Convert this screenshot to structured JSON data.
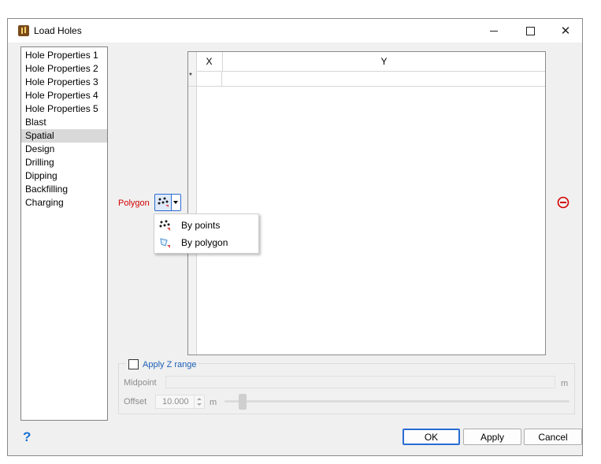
{
  "window": {
    "title": "Load Holes",
    "icon": "load-holes-app-icon",
    "controls": {
      "minimize": "minimize-icon",
      "maximize": "maximize-icon",
      "close": "close-icon",
      "close_glyph": "✕"
    }
  },
  "sidebar": {
    "items": [
      {
        "label": "Hole Properties 1"
      },
      {
        "label": "Hole Properties 2"
      },
      {
        "label": "Hole Properties 3"
      },
      {
        "label": "Hole Properties 4"
      },
      {
        "label": "Hole Properties 5"
      },
      {
        "label": "Blast"
      },
      {
        "label": "Spatial",
        "selected": true
      },
      {
        "label": "Design"
      },
      {
        "label": "Drilling"
      },
      {
        "label": "Dipping"
      },
      {
        "label": "Backfilling"
      },
      {
        "label": "Charging"
      }
    ]
  },
  "polygon": {
    "label": "Polygon",
    "label_color": "#d40000",
    "button_icon": "by-points-icon"
  },
  "grid": {
    "columns": [
      "X",
      "Y"
    ],
    "new_row_marker": "*"
  },
  "dropdown": {
    "items": [
      {
        "label": "By points",
        "icon": "by-points-icon"
      },
      {
        "label": "By polygon",
        "icon": "by-polygon-icon"
      }
    ]
  },
  "z_range": {
    "checkbox_label": "Apply Z range",
    "checked": false,
    "midpoint_label": "Midpoint",
    "midpoint_value": "",
    "midpoint_unit": "m",
    "offset_label": "Offset",
    "offset_value": "10.000",
    "offset_unit": "m"
  },
  "footer": {
    "help_glyph": "?",
    "ok_label": "OK",
    "apply_label": "Apply",
    "cancel_label": "Cancel"
  },
  "colors": {
    "accent": "#2a6bd3",
    "remove_icon": "#d40000",
    "link_text": "#1c5fb8"
  }
}
